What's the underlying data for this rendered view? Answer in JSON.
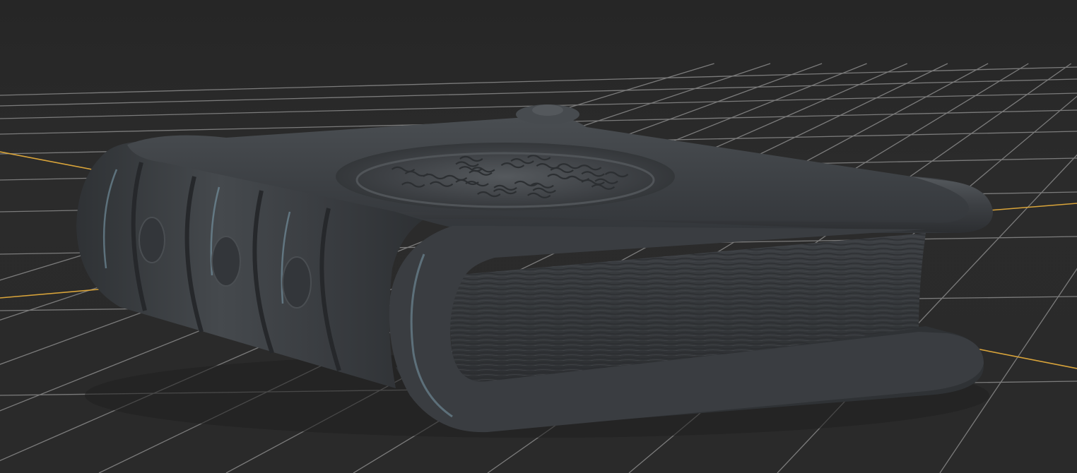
{
  "viewport": {
    "background": "#2a2a2a",
    "grid_color": "#8a8a8a",
    "axis_x_color": "#d9a43a",
    "axis_z_color": "#d9a43a",
    "model_color": "#3b3e41",
    "model_highlight": "#7fa3b3",
    "model_name": "sculpted-book-mesh"
  }
}
